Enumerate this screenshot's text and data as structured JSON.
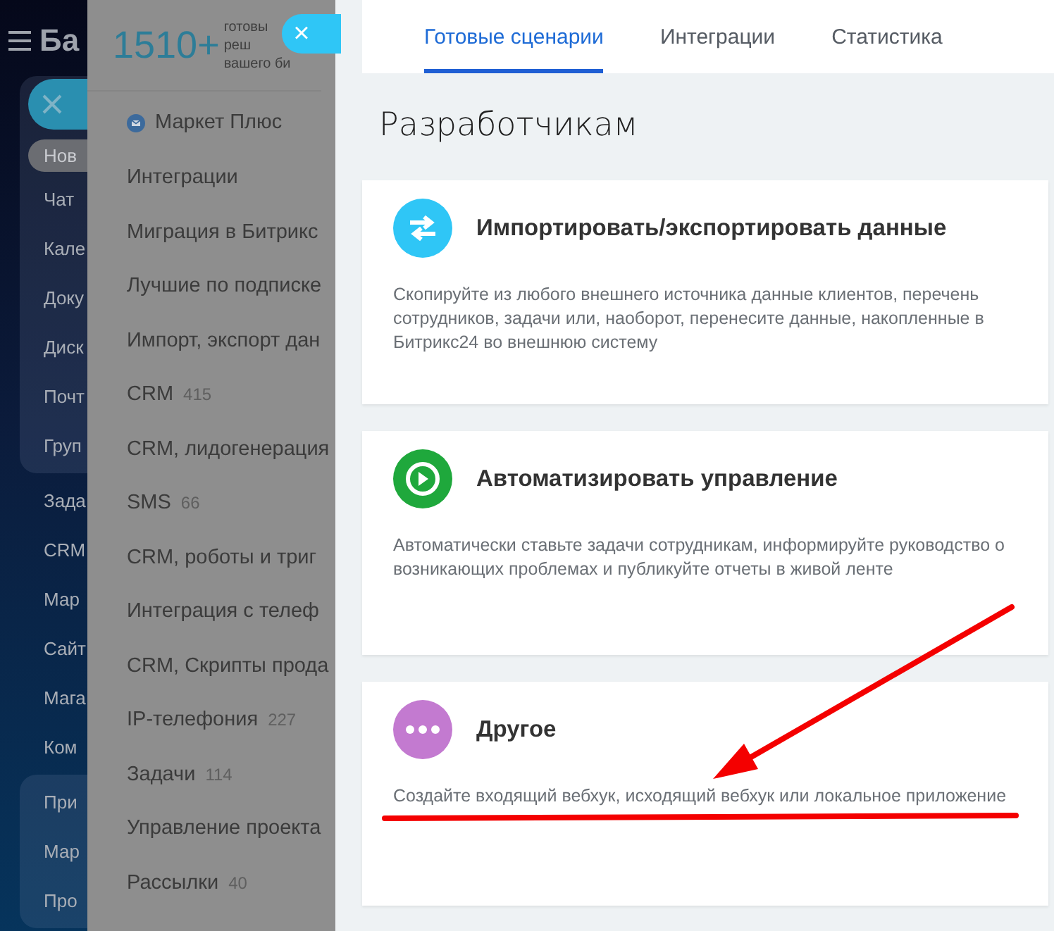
{
  "sidebar": {
    "title": "Ба",
    "groups": [
      {
        "kind": "panel",
        "items": [
          {
            "kind": "close-pill"
          },
          {
            "kind": "item",
            "label": "Нов",
            "selected": true
          },
          {
            "kind": "item",
            "label": "Чат",
            "selected": false
          },
          {
            "kind": "item",
            "label": "Кале",
            "selected": false
          },
          {
            "kind": "item",
            "label": "Доку",
            "selected": false
          },
          {
            "kind": "item",
            "label": "Диск",
            "selected": false
          },
          {
            "kind": "item",
            "label": "Почт",
            "selected": false
          },
          {
            "kind": "item",
            "label": "Груп",
            "selected": false
          }
        ]
      },
      {
        "kind": "plain",
        "items": [
          {
            "kind": "item",
            "label": "Зада",
            "selected": false
          },
          {
            "kind": "item",
            "label": "CRM",
            "selected": false
          },
          {
            "kind": "item",
            "label": "Мар",
            "selected": false
          },
          {
            "kind": "item",
            "label": "Сайт",
            "selected": false
          },
          {
            "kind": "item",
            "label": "Мага",
            "selected": false
          },
          {
            "kind": "item",
            "label": "Ком",
            "selected": false
          }
        ]
      },
      {
        "kind": "panel",
        "items": [
          {
            "kind": "item",
            "label": "При",
            "selected": false
          },
          {
            "kind": "item",
            "label": "Мар",
            "selected": false
          },
          {
            "kind": "item",
            "label": "Про",
            "selected": false
          }
        ]
      }
    ]
  },
  "market": {
    "count": "1510+",
    "tagline": [
      "готовы",
      "реш",
      "вашего би"
    ],
    "categories": [
      {
        "label": "Маркет Плюс",
        "kind": "plus"
      },
      {
        "label": "Интеграции"
      },
      {
        "label": "Миграция в Битрикс"
      },
      {
        "label": "Лучшие по подписке"
      },
      {
        "label": "Импорт, экспорт дан"
      },
      {
        "label": "CRM",
        "count": "415"
      },
      {
        "label": "CRM, лидогенерация"
      },
      {
        "label": "SMS",
        "count": "66"
      },
      {
        "label": "CRM, роботы и триг"
      },
      {
        "label": "Интеграция с телеф"
      },
      {
        "label": "CRM, Скрипты прода"
      },
      {
        "label": "IP-телефония",
        "count": "227"
      },
      {
        "label": "Задачи",
        "count": "114"
      },
      {
        "label": "Управление проекта"
      },
      {
        "label": "Рассылки",
        "count": "40"
      }
    ]
  },
  "close_button": {
    "label": "×"
  },
  "tabs": [
    {
      "label": "Готовые сценарии",
      "selected": true
    },
    {
      "label": "Интеграции",
      "selected": false
    },
    {
      "label": "Статистика",
      "selected": false
    }
  ],
  "heading": "Разработчикам",
  "cards": [
    {
      "kind": "exchange",
      "color": "#2fc6f6",
      "title": "Импортировать/экспортировать данные",
      "description": "Скопируйте из любого внешнего источника данные клиентов, перечень сотрудников, задачи или, наоборот, перенесите данные, накопленные в Битрикс24 во внешнюю систему"
    },
    {
      "kind": "play",
      "color": "#1fa83c",
      "title": "Автоматизировать управление",
      "description": "Автоматически ставьте задачи сотрудникам, информируйте руководство о возникающих проблемах и публикуйте отчеты в живой ленте"
    },
    {
      "kind": "more",
      "color": "#c37ad0",
      "title": "Другое",
      "description": "Создайте входящий вебхук, исходящий вебхук или локальное приложение"
    }
  ]
}
